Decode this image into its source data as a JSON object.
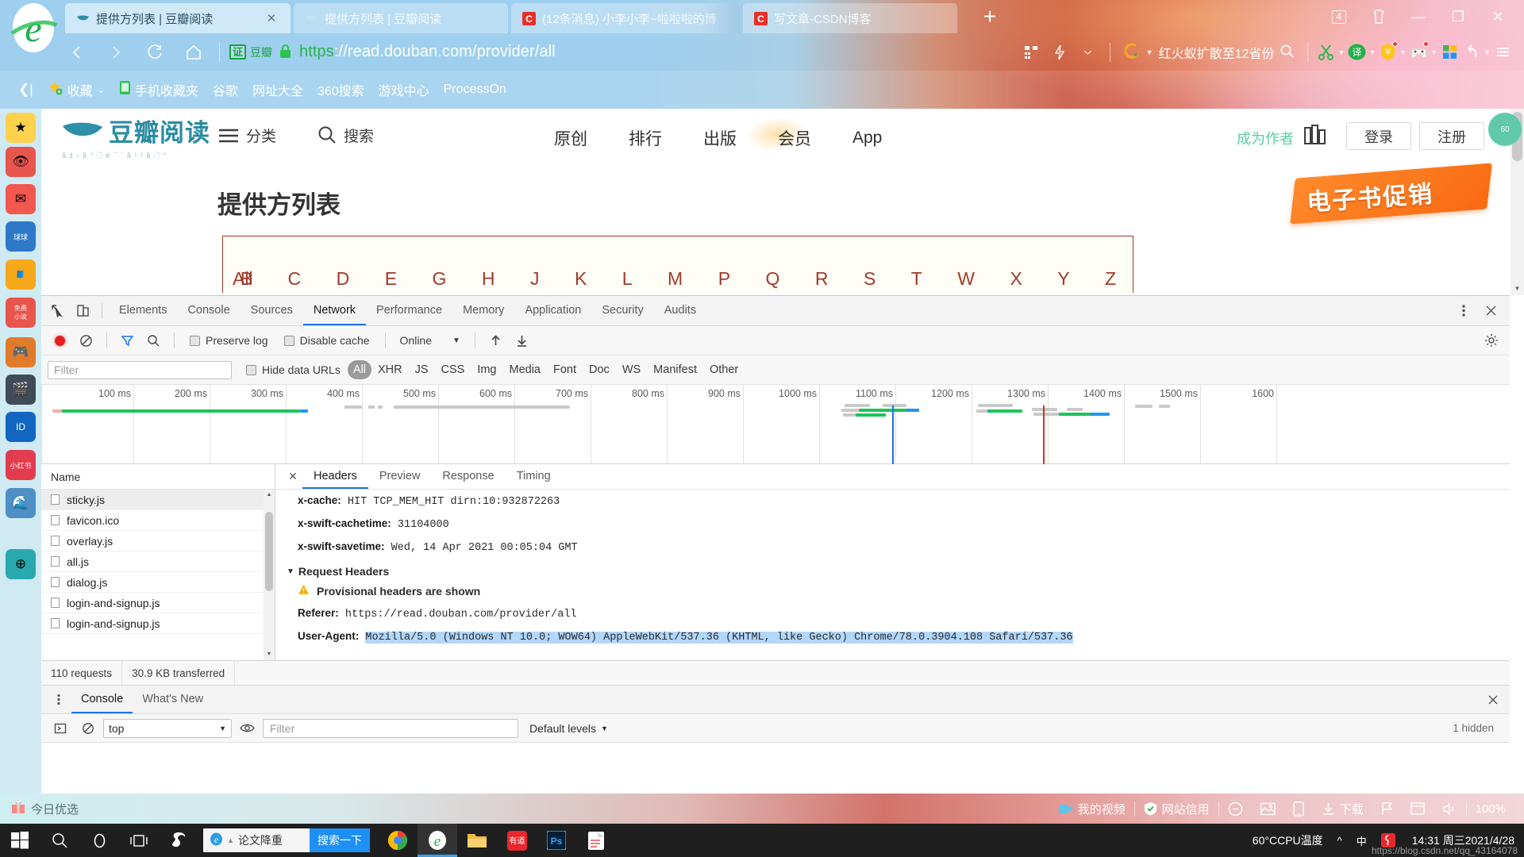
{
  "browser": {
    "tabs": [
      {
        "title": "提供方列表 | 豆瓣阅读",
        "favicon": "douban-bird-icon",
        "active": true,
        "close": "✕"
      },
      {
        "title": "提供方列表 | 豆瓣阅读",
        "favicon": "douban-bird-icon",
        "active": false,
        "close": ""
      },
      {
        "title": "(12条消息) 小李小李~啦啦啦的博",
        "favicon": "csdn-icon",
        "active": false,
        "close": ""
      },
      {
        "title": "写文章-CSDN博客",
        "favicon": "csdn-icon",
        "active": false,
        "close": ""
      }
    ],
    "newtab_label": "+",
    "window_controls": {
      "tab_count": "4",
      "clothes": "☖",
      "minimize": "—",
      "restore": "❐",
      "close": "✕"
    },
    "nav": {
      "back": "‹",
      "forward": "›",
      "reload": "⟳",
      "home": "⌂"
    },
    "address": {
      "cert_badge": "证",
      "cert_name": "豆瓣",
      "lock": "lock-icon",
      "scheme": "https",
      "rest": "://read.douban.com/provider/all"
    },
    "addr_icons": [
      "qr-code-icon",
      "lightning-icon",
      "chevron-down-icon"
    ],
    "search": {
      "engine": "360-search-icon",
      "text": "红火蚁扩散至12省份",
      "icon": "search-icon"
    },
    "extensions": [
      "scissors-icon",
      "translate-icon",
      "shield-coupon-icon",
      "game-controller-icon",
      "apps-grid-icon",
      "undo-icon",
      "menu-icon"
    ],
    "bookmarks": {
      "collapse": "❮|",
      "items": [
        "收藏",
        "手机收藏夹",
        "谷歌",
        "网址大全",
        "360搜索",
        "游戏中心",
        "ProcessOn"
      ]
    }
  },
  "webpage": {
    "logo_text": "豆瓣阅读",
    "logo_sub": "å ž ‹ å ° 🗋 è ¯ ´ å ¹ ³ å 🗋 °",
    "nav_left": [
      {
        "icon": "hamburger-icon",
        "label": "分类"
      },
      {
        "icon": "search-icon",
        "label": "搜索"
      }
    ],
    "main_nav": [
      "原创",
      "排行",
      "出版",
      "会员",
      "App"
    ],
    "become_author": "成为作者",
    "library_icon": "bookshelf-icon",
    "login": "登录",
    "signup": "注册",
    "promo_text": "电子书促销",
    "page_title": "提供方列表",
    "alpha_all": "All",
    "alphabet": [
      "B",
      "C",
      "D",
      "E",
      "G",
      "H",
      "J",
      "K",
      "L",
      "M",
      "P",
      "Q",
      "R",
      "S",
      "T",
      "W",
      "X",
      "Y",
      "Z"
    ],
    "float_badge": "60"
  },
  "devtools": {
    "main_tabs": [
      "Elements",
      "Console",
      "Sources",
      "Network",
      "Performance",
      "Memory",
      "Application",
      "Security",
      "Audits"
    ],
    "selected_main_tab": "Network",
    "left_icons": [
      "inspect-element-icon",
      "device-toolbar-icon"
    ],
    "right_icons": [
      "more-options-icon",
      "close-icon"
    ],
    "network_toolbar": {
      "record": "record-icon",
      "clear": "clear-icon",
      "filter": "filter-icon",
      "search": "search-icon",
      "preserve_log": "Preserve log",
      "disable_cache": "Disable cache",
      "throttle": "Online",
      "throttle_caret": "▼",
      "import": "import-har-icon",
      "export": "export-har-icon",
      "settings": "settings-gear-icon"
    },
    "filter_bar": {
      "filter_placeholder": "Filter",
      "hide_data_urls": "Hide data URLs",
      "types": [
        "All",
        "XHR",
        "JS",
        "CSS",
        "Img",
        "Media",
        "Font",
        "Doc",
        "WS",
        "Manifest",
        "Other"
      ],
      "selected_type": "All"
    },
    "timeline": {
      "ticks": [
        "100 ms",
        "200 ms",
        "300 ms",
        "400 ms",
        "500 ms",
        "600 ms",
        "700 ms",
        "800 ms",
        "900 ms",
        "1000 ms",
        "1100 ms",
        "1200 ms",
        "1300 ms",
        "1400 ms",
        "1500 ms",
        "1600"
      ],
      "dom_content_loaded_color": "#1a73e8",
      "load_color": "#d93025"
    },
    "requests": {
      "column_header": "Name",
      "rows": [
        {
          "name": "sticky.js",
          "highlight": true
        },
        {
          "name": "favicon.ico",
          "highlight": false
        },
        {
          "name": "overlay.js",
          "highlight": false
        },
        {
          "name": "all.js",
          "highlight": false
        },
        {
          "name": "dialog.js",
          "highlight": false
        },
        {
          "name": "login-and-signup.js",
          "highlight": false
        },
        {
          "name": "login-and-signup.js",
          "highlight": false
        }
      ]
    },
    "detail": {
      "close": "✕",
      "tabs": [
        "Headers",
        "Preview",
        "Response",
        "Timing"
      ],
      "selected_tab": "Headers",
      "response_headers": [
        {
          "key": "x-cache:",
          "value": "HIT TCP_MEM_HIT dirn:10:932872263"
        },
        {
          "key": "x-swift-cachetime:",
          "value": "31104000"
        },
        {
          "key": "x-swift-savetime:",
          "value": "Wed, 14 Apr 2021 00:05:04 GMT"
        }
      ],
      "request_headers_title": "Request Headers",
      "provisional_warning": "Provisional headers are shown",
      "request_headers": [
        {
          "key": "Referer:",
          "value": "https://read.douban.com/provider/all",
          "selected": false
        },
        {
          "key": "User-Agent:",
          "value": "Mozilla/5.0 (Windows NT 10.0; WOW64) AppleWebKit/537.36 (KHTML, like Gecko) Chrome/78.0.3904.108 Safari/537.36",
          "selected": true
        }
      ]
    },
    "status": {
      "requests": "110 requests",
      "transferred": "30.9 KB transferred"
    },
    "drawer": {
      "menu_icon": "drawer-menu-icon",
      "tabs": [
        "Console",
        "What's New"
      ],
      "selected_tab": "Console",
      "close": "✕"
    },
    "console": {
      "execute": "execute-icon",
      "clear": "clear-icon",
      "context": "top",
      "context_caret": "▼",
      "eye": "eye-icon",
      "filter_placeholder": "Filter",
      "levels": "Default levels",
      "levels_caret": "▼",
      "hidden": "1 hidden"
    }
  },
  "statusbar": {
    "left_icon": "gift-icon",
    "left_text": "今日优选",
    "items": [
      {
        "icon": "video-icon",
        "label": "我的视频"
      },
      {
        "icon": "shield-icon",
        "label": "网站信用"
      },
      {
        "icon": "mute-icon",
        "label": ""
      },
      {
        "icon": "image-icon",
        "label": ""
      },
      {
        "icon": "mobile-icon",
        "label": ""
      },
      {
        "icon": "download-icon",
        "label": "下载"
      },
      {
        "icon": "flag-icon",
        "label": ""
      },
      {
        "icon": "window-icon",
        "label": ""
      },
      {
        "icon": "speaker-icon",
        "label": ""
      },
      {
        "icon": "zoom-label",
        "label": "100%"
      }
    ]
  },
  "taskbar": {
    "start": "windows-start-icon",
    "icons": [
      "search-icon",
      "cortana-icon",
      "task-view-icon",
      "sogou-icon"
    ],
    "search_box": {
      "icon": "ie-icon",
      "value": "论文降重",
      "button": "搜索一下"
    },
    "apps": [
      "chrome-icon",
      "ie-icon",
      "file-explorer-icon",
      "youdao-icon",
      "photoshop-icon",
      "wps-icon"
    ],
    "tray": {
      "chevron": "^",
      "ime": "中",
      "extra_icon": "sogou-ime-icon",
      "temp_value": "60°C",
      "temp_label": "CPU温度",
      "time": "14:31",
      "weekday": "周三",
      "date": "2021/4/28"
    },
    "watermark": "https://blog.csdn.net/qq_43164078"
  }
}
